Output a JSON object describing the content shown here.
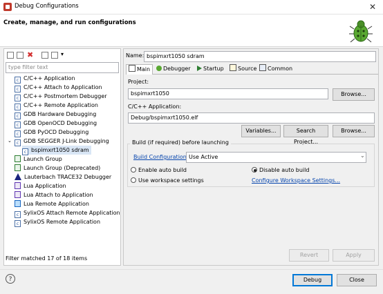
{
  "window": {
    "title": "Debug Configurations",
    "close_glyph": "✕"
  },
  "header": {
    "title": "Create, manage, and run configurations"
  },
  "left": {
    "filter_placeholder": "type filter text",
    "tree": [
      {
        "label": "C/C++ Application",
        "icon": "c-file-icon"
      },
      {
        "label": "C/C++ Attach to Application",
        "icon": "c-file-icon"
      },
      {
        "label": "C/C++ Postmortem Debugger",
        "icon": "c-file-icon"
      },
      {
        "label": "C/C++ Remote Application",
        "icon": "c-file-icon"
      },
      {
        "label": "GDB Hardware Debugging",
        "icon": "c-file-icon"
      },
      {
        "label": "GDB OpenOCD Debugging",
        "icon": "c-file-icon"
      },
      {
        "label": "GDB PyOCD Debugging",
        "icon": "c-file-icon"
      },
      {
        "label": "GDB SEGGER J-Link Debugging",
        "icon": "c-file-icon"
      },
      {
        "label": "bspimxrt1050 sdram",
        "icon": "c-file-icon"
      },
      {
        "label": "Launch Group",
        "icon": "launch-group-icon"
      },
      {
        "label": "Launch Group (Deprecated)",
        "icon": "launch-group-icon"
      },
      {
        "label": "Lauterbach TRACE32 Debugger",
        "icon": "trace32-icon"
      },
      {
        "label": "Lua Application",
        "icon": "lua-icon"
      },
      {
        "label": "Lua Attach to Application",
        "icon": "lua-icon"
      },
      {
        "label": "Lua Remote Application",
        "icon": "lua-icon"
      },
      {
        "label": "SylixOS Attach Remote Application",
        "icon": "c-file-icon"
      },
      {
        "label": "SylixOS Remote Application",
        "icon": "c-file-icon"
      }
    ],
    "status": "Filter matched 17 of 18 items"
  },
  "right": {
    "name_label": "Name:",
    "name_value": "bspimxrt1050 sdram",
    "tabs": [
      "Main",
      "Debugger",
      "Startup",
      "Source",
      "Common"
    ],
    "project_label": "Project:",
    "project_value": "bspimxrt1050",
    "browse": "Browse...",
    "app_label": "C/C++ Application:",
    "app_value": "Debug/bspimxrt1050.elf",
    "variables": "Variables...",
    "search_project": "Search Project...",
    "build_group": "Build (if required) before launching",
    "build_config_link": "Build Configuration:",
    "build_config_value": "Use Active",
    "enable_auto": "Enable auto build",
    "disable_auto": "Disable auto build",
    "use_workspace": "Use workspace settings",
    "configure_link": "Configure Workspace Settings...",
    "revert": "Revert",
    "apply": "Apply"
  },
  "footer": {
    "help": "?",
    "debug": "Debug",
    "close": "Close"
  }
}
